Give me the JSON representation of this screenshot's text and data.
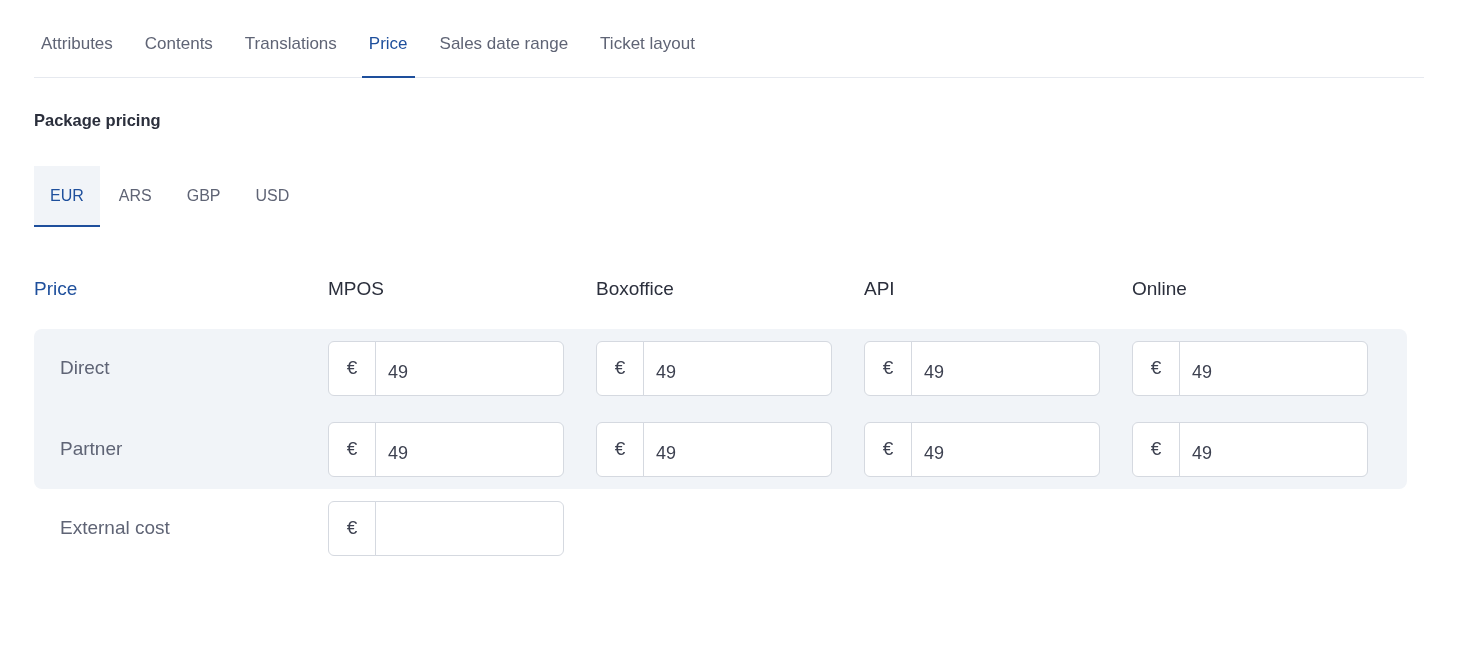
{
  "tabs": [
    {
      "label": "Attributes",
      "selected": false
    },
    {
      "label": "Contents",
      "selected": false
    },
    {
      "label": "Translations",
      "selected": false
    },
    {
      "label": "Price",
      "selected": true
    },
    {
      "label": "Sales date range",
      "selected": false
    },
    {
      "label": "Ticket layout",
      "selected": false
    }
  ],
  "section_title": "Package pricing",
  "currencies": [
    {
      "label": "EUR",
      "selected": true
    },
    {
      "label": "ARS",
      "selected": false
    },
    {
      "label": "GBP",
      "selected": false
    },
    {
      "label": "USD",
      "selected": false
    }
  ],
  "price_table": {
    "columns": [
      "Price",
      "MPOS",
      "Boxoffice",
      "API",
      "Online"
    ],
    "groups": [
      {
        "shaded": true,
        "rows": [
          {
            "label": "Direct",
            "cells": [
              {
                "symbol": "€",
                "value": "49"
              },
              {
                "symbol": "€",
                "value": "49"
              },
              {
                "symbol": "€",
                "value": "49"
              },
              {
                "symbol": "€",
                "value": "49"
              }
            ]
          },
          {
            "label": "Partner",
            "cells": [
              {
                "symbol": "€",
                "value": "49"
              },
              {
                "symbol": "€",
                "value": "49"
              },
              {
                "symbol": "€",
                "value": "49"
              },
              {
                "symbol": "€",
                "value": "49"
              }
            ]
          }
        ]
      },
      {
        "shaded": false,
        "rows": [
          {
            "label": "External cost",
            "cells": [
              {
                "symbol": "€"
              }
            ]
          }
        ]
      }
    ]
  }
}
